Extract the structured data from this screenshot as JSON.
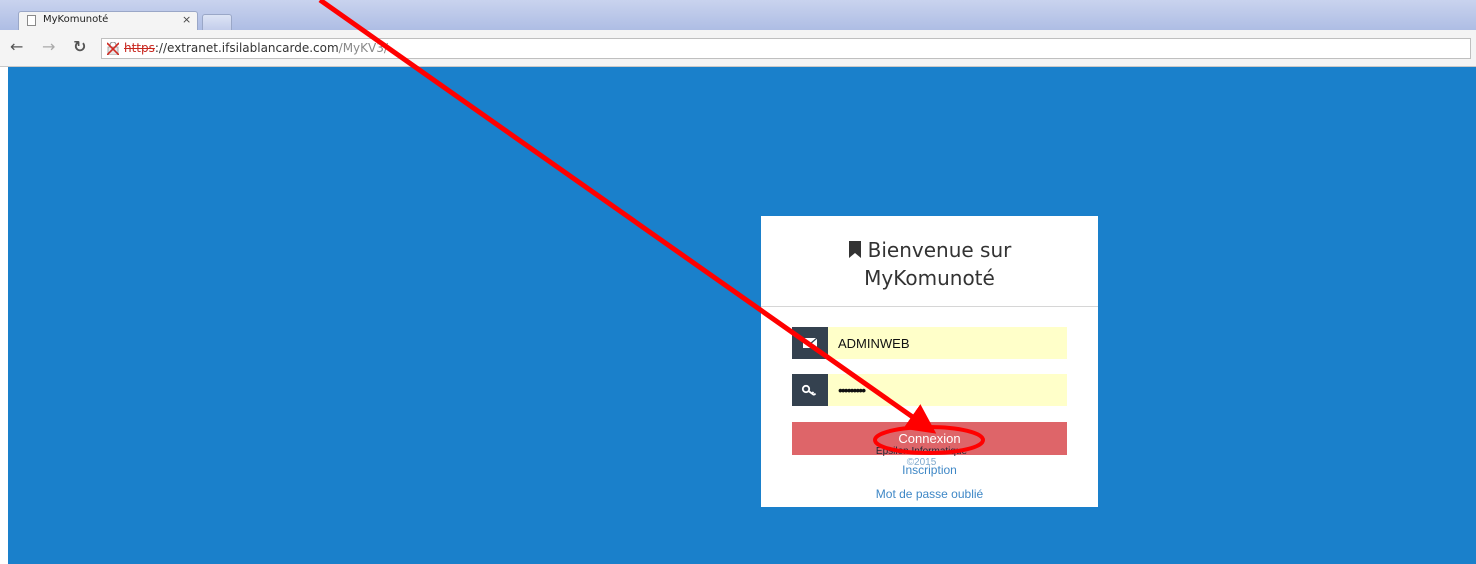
{
  "browser": {
    "tab_title": "MyKomunoté",
    "tab_close": "×",
    "url_scheme": "https",
    "url_host": "://extranet.ifsilablancarde.com",
    "url_path": "/MyKV3/"
  },
  "login": {
    "heading_line1": "Bienvenue sur",
    "heading_line2": "MyKomunoté",
    "username_value": "ADMINWEB",
    "password_value": "•••••••••",
    "submit_label": "Connexion",
    "register_link": "Inscription",
    "forgot_link": "Mot de passe oublié"
  },
  "footer": {
    "company": "Epsilon Informatique",
    "copyright": "©2015"
  },
  "colors": {
    "page_background": "#1a80cb",
    "button": "#de6569",
    "input_background": "#ffffc9",
    "icon_box": "#34414f",
    "annotation": "#ff0000"
  },
  "icons": [
    "page-icon",
    "close-icon",
    "back-icon",
    "forward-icon",
    "reload-icon",
    "insecure-lock-icon",
    "bookmark-icon",
    "envelope-icon",
    "key-icon"
  ]
}
